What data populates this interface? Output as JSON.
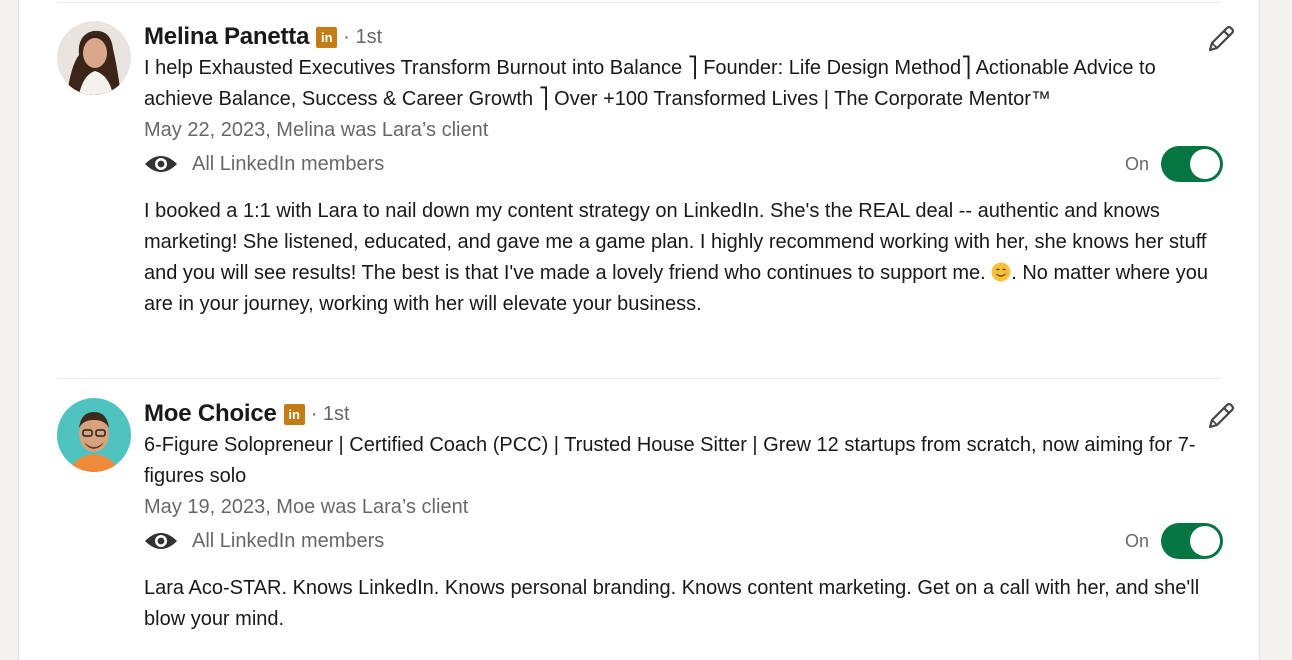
{
  "recommendations": [
    {
      "name": "Melina Panetta",
      "badge": "in",
      "degree": "· 1st",
      "headline": "I help Exhausted Executives Transform Burnout into Balance ⎤ Founder: Life Design Method⎤ Actionable Advice to achieve Balance, Success & Career Growth ⎤ Over +100 Transformed Lives | The Corporate Mentor™",
      "meta": "May 22, 2023, Melina was Lara’s client",
      "visibility": "All LinkedIn members",
      "toggle_label": "On",
      "text_before_emoji": "I booked a 1:1 with Lara to nail down my content strategy on LinkedIn. She's the REAL deal -- authentic and knows marketing! She listened, educated, and gave me a game plan. I highly recommend working with her, she knows her stuff and you will see results! The best is that I've made a lovely friend who continues to support me. ",
      "text_after_emoji": ". No matter where you are in your journey, working with her will elevate your business.",
      "avatar_bg": "#e9e4df"
    },
    {
      "name": "Moe Choice",
      "badge": "in",
      "degree": "· 1st",
      "headline": "6-Figure Solopreneur | Certified Coach (PCC) | Trusted House Sitter | Grew 12 startups from scratch, now aiming for 7-figures solo",
      "meta": "May 19, 2023, Moe was Lara’s client",
      "visibility": "All LinkedIn members",
      "toggle_label": "On",
      "text": "Lara Aco-STAR. Knows LinkedIn. Knows personal branding. Knows content marketing. Get on a call with her, and she'll blow your mind.",
      "avatar_bg": "#4fc3c0"
    }
  ],
  "colors": {
    "toggle_on": "#057642",
    "linkedin_badge": "#c37d16",
    "text_primary": "rgba(0,0,0,0.9)",
    "text_secondary": "rgba(0,0,0,0.6)"
  },
  "icons": [
    "eye-icon",
    "pencil-icon",
    "linkedin-icon",
    "smile-emoji-icon"
  ]
}
